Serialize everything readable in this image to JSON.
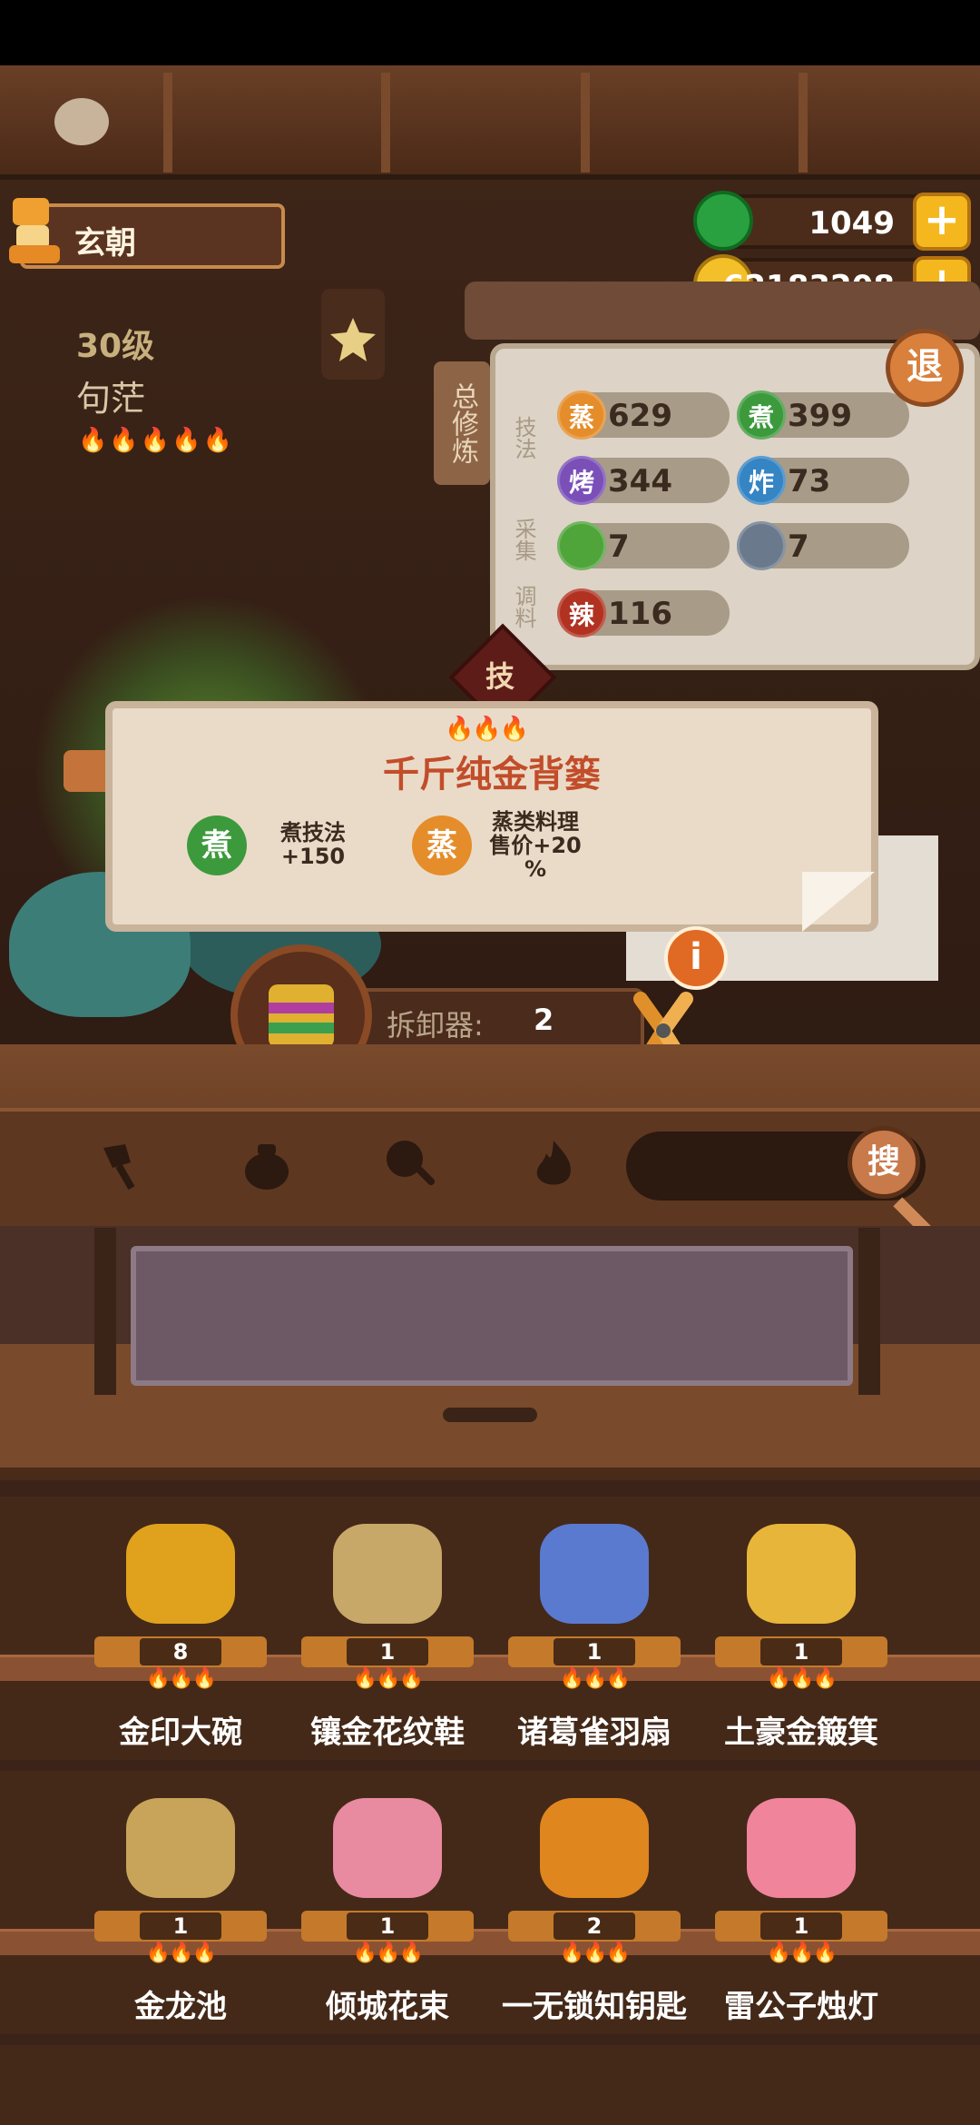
{
  "player": {
    "name": "玄朝",
    "level": "30级",
    "title": "句茫",
    "flames": "🔥🔥🔥🔥🔥"
  },
  "currency": {
    "jade": "1049",
    "gold": "62183208",
    "plus": "+"
  },
  "stats": {
    "side_label": "总修炼",
    "sections": {
      "technique": "技法",
      "gather": "采集",
      "season": "调料"
    },
    "items": [
      {
        "icon": "蒸",
        "value": "629",
        "color": "#e58d2a"
      },
      {
        "icon": "煮",
        "value": "399",
        "color": "#3c9a3c"
      },
      {
        "icon": "烤",
        "value": "344",
        "color": "#7a4fb8"
      },
      {
        "icon": "炸",
        "value": "73",
        "color": "#3584c4"
      },
      {
        "icon": "cabbage-icon",
        "value": "7",
        "color": "#4fa43a"
      },
      {
        "icon": "fish-icon",
        "value": "7",
        "color": "#6a7a8c"
      },
      {
        "icon": "辣",
        "value": "116",
        "color": "#b23222"
      }
    ],
    "exit": "退",
    "skill_tab": "技"
  },
  "tooltip": {
    "flames": "🔥🔥🔥",
    "title": "千斤纯金背篓",
    "effects": [
      {
        "icon": "煮",
        "text_line1": "煮技法",
        "text_line2": "+150",
        "text_line3": "",
        "color": "#3c9a3c"
      },
      {
        "icon": "蒸",
        "text_line1": "蒸类料理",
        "text_line2": "售价+20",
        "text_line3": "%",
        "color": "#e58d2a"
      }
    ]
  },
  "paper_fragment": "%",
  "dismantle": {
    "label": "拆卸器:",
    "count": "2",
    "info": "i"
  },
  "search": {
    "button": "搜"
  },
  "filters": [
    "shovel-icon",
    "sack-icon",
    "pan-icon",
    "flame-icon"
  ],
  "inventory": [
    {
      "name": "金印大碗",
      "count": "8",
      "flames": "🔥🔥🔥",
      "color": "#e0a21c"
    },
    {
      "name": "镶金花纹鞋",
      "count": "1",
      "flames": "🔥🔥🔥",
      "color": "#c7a868"
    },
    {
      "name": "诸葛雀羽扇",
      "count": "1",
      "flames": "🔥🔥🔥",
      "color": "#5a7ad0"
    },
    {
      "name": "土豪金簸箕",
      "count": "1",
      "flames": "🔥🔥🔥",
      "color": "#e7b53a"
    },
    {
      "name": "金龙池",
      "count": "1",
      "flames": "🔥🔥🔥",
      "color": "#c8a45a"
    },
    {
      "name": "倾城花束",
      "count": "1",
      "flames": "🔥🔥🔥",
      "color": "#e88aa0"
    },
    {
      "name": "一无锁知钥匙",
      "count": "2",
      "flames": "🔥🔥🔥",
      "color": "#e0861e"
    },
    {
      "name": "雷公子烛灯",
      "count": "1",
      "flames": "🔥🔥🔥",
      "color": "#f0849a"
    }
  ]
}
